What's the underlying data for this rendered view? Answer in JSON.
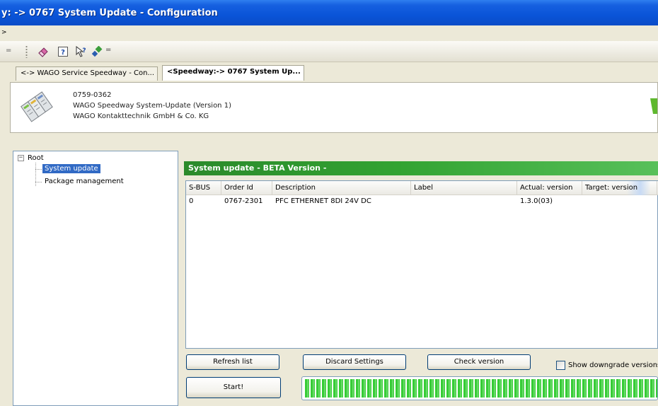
{
  "window": {
    "title": "y: -> 0767 System Update - Configuration"
  },
  "menu": {
    "partial_item": ">"
  },
  "toolbar": {
    "grip_left": "=",
    "overflow": "="
  },
  "tabs": [
    {
      "label": "<-> WAGO Service Speedway - Con..."
    },
    {
      "label": "<Speedway:-> 0767 System Up..."
    }
  ],
  "device": {
    "order_number": "0759-0362",
    "product_name": "WAGO Speedway System-Update (Version 1)",
    "manufacturer": "WAGO Kontakttechnik GmbH & Co. KG"
  },
  "tree": {
    "root_label": "Root",
    "expander": "−",
    "items": [
      {
        "label": "System update"
      },
      {
        "label": "Package management"
      }
    ]
  },
  "panel": {
    "header": "System update - BETA Version -"
  },
  "table": {
    "columns": [
      "S-BUS",
      "Order Id",
      "Description",
      "Label",
      "Actual: version",
      "Target: version"
    ],
    "rows": [
      {
        "sbus": "0",
        "order_id": "0767-2301",
        "description": "PFC ETHERNET 8DI 24V DC",
        "label": "",
        "actual_version": "1.3.0(03)",
        "target_version": ""
      }
    ]
  },
  "buttons": {
    "refresh": "Refresh list",
    "discard": "Discard Settings",
    "check": "Check version",
    "start": "Start!"
  },
  "options": {
    "show_downgrade": "Show downgrade versions",
    "show_downgrade_checked": false
  },
  "progress": {
    "fraction": 1.0
  },
  "colors": {
    "title_bar": "#0a54d8",
    "panel_header": "#32a332",
    "progress": "#3fd33f",
    "selection": "#316ac5"
  }
}
